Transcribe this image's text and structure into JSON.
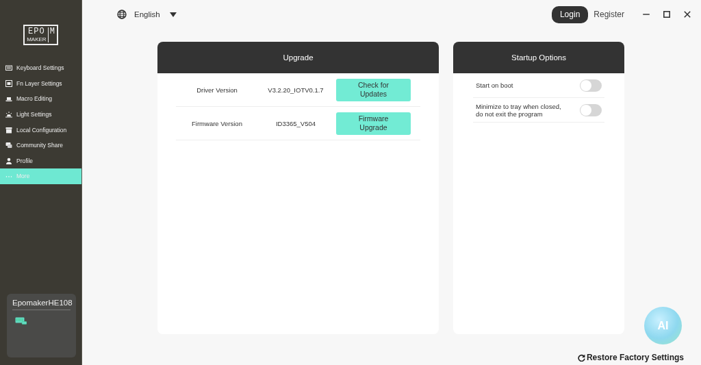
{
  "sidebar": {
    "logo": {
      "top": "EPO",
      "bottom": "MAKER",
      "side": "M"
    },
    "items": [
      {
        "label": "Keyboard Settings",
        "selected": false
      },
      {
        "label": "Fn Layer Settings",
        "selected": false
      },
      {
        "label": "Macro Editing",
        "selected": false
      },
      {
        "label": "Light Settings",
        "selected": false
      },
      {
        "label": "Local Configuration",
        "selected": false
      },
      {
        "label": "Community Share",
        "selected": false
      },
      {
        "label": "Profile",
        "selected": false
      },
      {
        "label": "More",
        "selected": true
      }
    ],
    "device": {
      "name": "EpomakerHE108"
    }
  },
  "language": {
    "value": "English"
  },
  "account": {
    "login": "Login",
    "register": "Register"
  },
  "upgrade": {
    "title": "Upgrade",
    "rows": [
      {
        "label": "Driver Version",
        "value": "V3.2.20_IOTV0.1.7",
        "button": "Check for Updates"
      },
      {
        "label": "Firmware Version",
        "value": "ID3365_V504",
        "button": "Firmware Upgrade"
      }
    ]
  },
  "startup": {
    "title": "Startup Options",
    "options": [
      {
        "label": "Start on boot",
        "on": false
      },
      {
        "label": "Minimize to tray when closed, do not exit the program",
        "on": false
      }
    ]
  },
  "assistant": {
    "label": "AI"
  },
  "restore": {
    "label": "Restore Factory Settings"
  }
}
